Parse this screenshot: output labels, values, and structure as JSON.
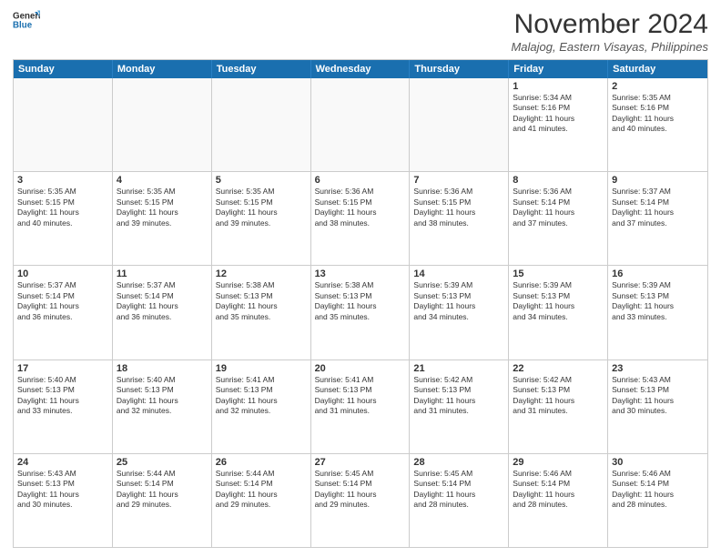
{
  "logo": {
    "line1": "General",
    "line2": "Blue"
  },
  "title": "November 2024",
  "location": "Malajog, Eastern Visayas, Philippines",
  "header_days": [
    "Sunday",
    "Monday",
    "Tuesday",
    "Wednesday",
    "Thursday",
    "Friday",
    "Saturday"
  ],
  "rows": [
    [
      {
        "day": "",
        "info": ""
      },
      {
        "day": "",
        "info": ""
      },
      {
        "day": "",
        "info": ""
      },
      {
        "day": "",
        "info": ""
      },
      {
        "day": "",
        "info": ""
      },
      {
        "day": "1",
        "info": "Sunrise: 5:34 AM\nSunset: 5:16 PM\nDaylight: 11 hours\nand 41 minutes."
      },
      {
        "day": "2",
        "info": "Sunrise: 5:35 AM\nSunset: 5:16 PM\nDaylight: 11 hours\nand 40 minutes."
      }
    ],
    [
      {
        "day": "3",
        "info": "Sunrise: 5:35 AM\nSunset: 5:15 PM\nDaylight: 11 hours\nand 40 minutes."
      },
      {
        "day": "4",
        "info": "Sunrise: 5:35 AM\nSunset: 5:15 PM\nDaylight: 11 hours\nand 39 minutes."
      },
      {
        "day": "5",
        "info": "Sunrise: 5:35 AM\nSunset: 5:15 PM\nDaylight: 11 hours\nand 39 minutes."
      },
      {
        "day": "6",
        "info": "Sunrise: 5:36 AM\nSunset: 5:15 PM\nDaylight: 11 hours\nand 38 minutes."
      },
      {
        "day": "7",
        "info": "Sunrise: 5:36 AM\nSunset: 5:15 PM\nDaylight: 11 hours\nand 38 minutes."
      },
      {
        "day": "8",
        "info": "Sunrise: 5:36 AM\nSunset: 5:14 PM\nDaylight: 11 hours\nand 37 minutes."
      },
      {
        "day": "9",
        "info": "Sunrise: 5:37 AM\nSunset: 5:14 PM\nDaylight: 11 hours\nand 37 minutes."
      }
    ],
    [
      {
        "day": "10",
        "info": "Sunrise: 5:37 AM\nSunset: 5:14 PM\nDaylight: 11 hours\nand 36 minutes."
      },
      {
        "day": "11",
        "info": "Sunrise: 5:37 AM\nSunset: 5:14 PM\nDaylight: 11 hours\nand 36 minutes."
      },
      {
        "day": "12",
        "info": "Sunrise: 5:38 AM\nSunset: 5:13 PM\nDaylight: 11 hours\nand 35 minutes."
      },
      {
        "day": "13",
        "info": "Sunrise: 5:38 AM\nSunset: 5:13 PM\nDaylight: 11 hours\nand 35 minutes."
      },
      {
        "day": "14",
        "info": "Sunrise: 5:39 AM\nSunset: 5:13 PM\nDaylight: 11 hours\nand 34 minutes."
      },
      {
        "day": "15",
        "info": "Sunrise: 5:39 AM\nSunset: 5:13 PM\nDaylight: 11 hours\nand 34 minutes."
      },
      {
        "day": "16",
        "info": "Sunrise: 5:39 AM\nSunset: 5:13 PM\nDaylight: 11 hours\nand 33 minutes."
      }
    ],
    [
      {
        "day": "17",
        "info": "Sunrise: 5:40 AM\nSunset: 5:13 PM\nDaylight: 11 hours\nand 33 minutes."
      },
      {
        "day": "18",
        "info": "Sunrise: 5:40 AM\nSunset: 5:13 PM\nDaylight: 11 hours\nand 32 minutes."
      },
      {
        "day": "19",
        "info": "Sunrise: 5:41 AM\nSunset: 5:13 PM\nDaylight: 11 hours\nand 32 minutes."
      },
      {
        "day": "20",
        "info": "Sunrise: 5:41 AM\nSunset: 5:13 PM\nDaylight: 11 hours\nand 31 minutes."
      },
      {
        "day": "21",
        "info": "Sunrise: 5:42 AM\nSunset: 5:13 PM\nDaylight: 11 hours\nand 31 minutes."
      },
      {
        "day": "22",
        "info": "Sunrise: 5:42 AM\nSunset: 5:13 PM\nDaylight: 11 hours\nand 31 minutes."
      },
      {
        "day": "23",
        "info": "Sunrise: 5:43 AM\nSunset: 5:13 PM\nDaylight: 11 hours\nand 30 minutes."
      }
    ],
    [
      {
        "day": "24",
        "info": "Sunrise: 5:43 AM\nSunset: 5:13 PM\nDaylight: 11 hours\nand 30 minutes."
      },
      {
        "day": "25",
        "info": "Sunrise: 5:44 AM\nSunset: 5:14 PM\nDaylight: 11 hours\nand 29 minutes."
      },
      {
        "day": "26",
        "info": "Sunrise: 5:44 AM\nSunset: 5:14 PM\nDaylight: 11 hours\nand 29 minutes."
      },
      {
        "day": "27",
        "info": "Sunrise: 5:45 AM\nSunset: 5:14 PM\nDaylight: 11 hours\nand 29 minutes."
      },
      {
        "day": "28",
        "info": "Sunrise: 5:45 AM\nSunset: 5:14 PM\nDaylight: 11 hours\nand 28 minutes."
      },
      {
        "day": "29",
        "info": "Sunrise: 5:46 AM\nSunset: 5:14 PM\nDaylight: 11 hours\nand 28 minutes."
      },
      {
        "day": "30",
        "info": "Sunrise: 5:46 AM\nSunset: 5:14 PM\nDaylight: 11 hours\nand 28 minutes."
      }
    ]
  ]
}
